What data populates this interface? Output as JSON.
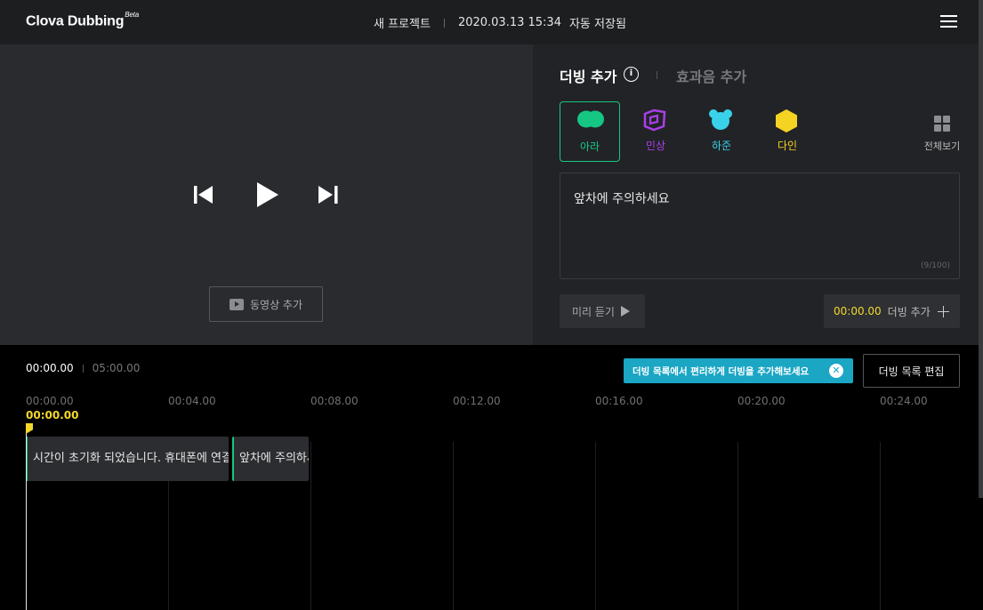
{
  "header": {
    "app_name": "Clova Dubbing",
    "app_badge": "Beta",
    "project_name": "새 프로젝트",
    "datetime": "2020.03.13 15:34",
    "save_status": "자동 저장됨",
    "menu_icon": "hamburger-icon"
  },
  "video": {
    "prev_icon": "skip-previous-icon",
    "play_icon": "play-icon",
    "next_icon": "skip-next-icon",
    "add_video_label": "동영상 추가"
  },
  "panel": {
    "tabs": [
      {
        "label": "더빙 추가",
        "active": true
      },
      {
        "label": "효과음 추가",
        "active": false
      }
    ],
    "info_icon": "i",
    "voices": [
      {
        "name": "아라",
        "color": "#16c784",
        "selected": true
      },
      {
        "name": "민상",
        "color": "#a93fe8",
        "selected": false
      },
      {
        "name": "하준",
        "color": "#39d2ea",
        "selected": false
      },
      {
        "name": "다인",
        "color": "#f4d323",
        "selected": false
      }
    ],
    "view_all_label": "전체보기",
    "text_value": "앞차에 주의하세요",
    "char_count": "(9/100)",
    "preview_label": "미리 듣기",
    "add_dub_time": "00:00.00",
    "add_dub_label": "더빙 추가"
  },
  "timeline": {
    "current_time": "00:00.00",
    "total_time": "05:00.00",
    "tooltip_text": "더빙 목록에서 편리하게 더빙을 추가해보세요",
    "edit_list_label": "더빙 목록 편집",
    "ruler": [
      "00:00.00",
      "00:04.00",
      "00:08.00",
      "00:12.00",
      "00:16.00",
      "00:20.00",
      "00:24.00"
    ],
    "playhead_time": "00:00.00",
    "clips": [
      {
        "text": "시간이 초기화 되었습니다. 휴대폰에 연결해주세요"
      },
      {
        "text": "앞차에 주의하세요"
      }
    ]
  }
}
